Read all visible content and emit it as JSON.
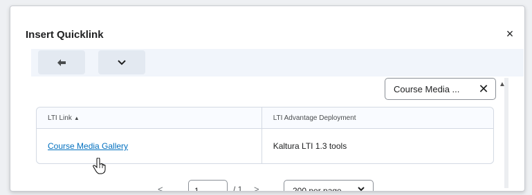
{
  "dialog": {
    "title": "Insert Quicklink",
    "close_label": "×"
  },
  "toolbar": {
    "back_icon": "back-arrow-icon",
    "more_icon": "chevron-down-icon"
  },
  "search": {
    "value": "Course Media ...",
    "clear_label": "✕"
  },
  "table": {
    "columns": [
      "LTI Link",
      "LTI Advantage Deployment"
    ],
    "sort_indicator": "▲",
    "rows": [
      {
        "link": "Course Media Gallery",
        "deployment": "Kaltura LTI 1.3 tools"
      }
    ]
  },
  "pager": {
    "prev": "<",
    "page": "1",
    "total": "/ 1",
    "next": ">",
    "page_size": "200 per page"
  },
  "colors": {
    "link": "#006fbf",
    "toolbar_bg": "#f1f5fb",
    "button_bg": "#e3e9f1"
  }
}
